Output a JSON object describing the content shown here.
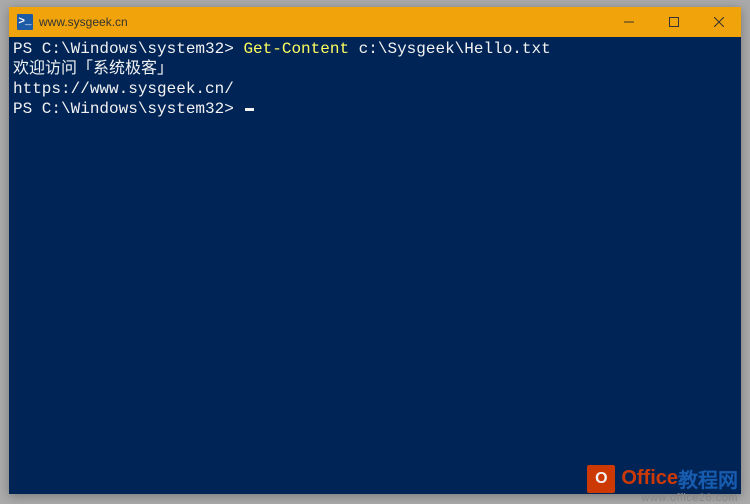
{
  "window": {
    "title": "www.sysgeek.cn",
    "icon_label": ">_"
  },
  "terminal": {
    "lines": [
      {
        "segments": [
          {
            "text": "PS C:\\Windows\\system32> ",
            "cls": "prompt"
          },
          {
            "text": "Get-Content",
            "cls": "cmdlet"
          },
          {
            "text": " c:\\Sysgeek\\Hello.txt",
            "cls": "arg"
          }
        ]
      },
      {
        "segments": [
          {
            "text": "欢迎访问「系统极客」",
            "cls": ""
          }
        ]
      },
      {
        "segments": [
          {
            "text": "",
            "cls": ""
          }
        ]
      },
      {
        "segments": [
          {
            "text": "https://www.sysgeek.cn/",
            "cls": ""
          }
        ]
      },
      {
        "segments": [
          {
            "text": "PS C:\\Windows\\system32> ",
            "cls": "prompt"
          }
        ],
        "cursor": true
      }
    ]
  },
  "watermark": {
    "icon": "O",
    "text1": "Office",
    "text2": "教程网",
    "url": "www.office26.com"
  }
}
